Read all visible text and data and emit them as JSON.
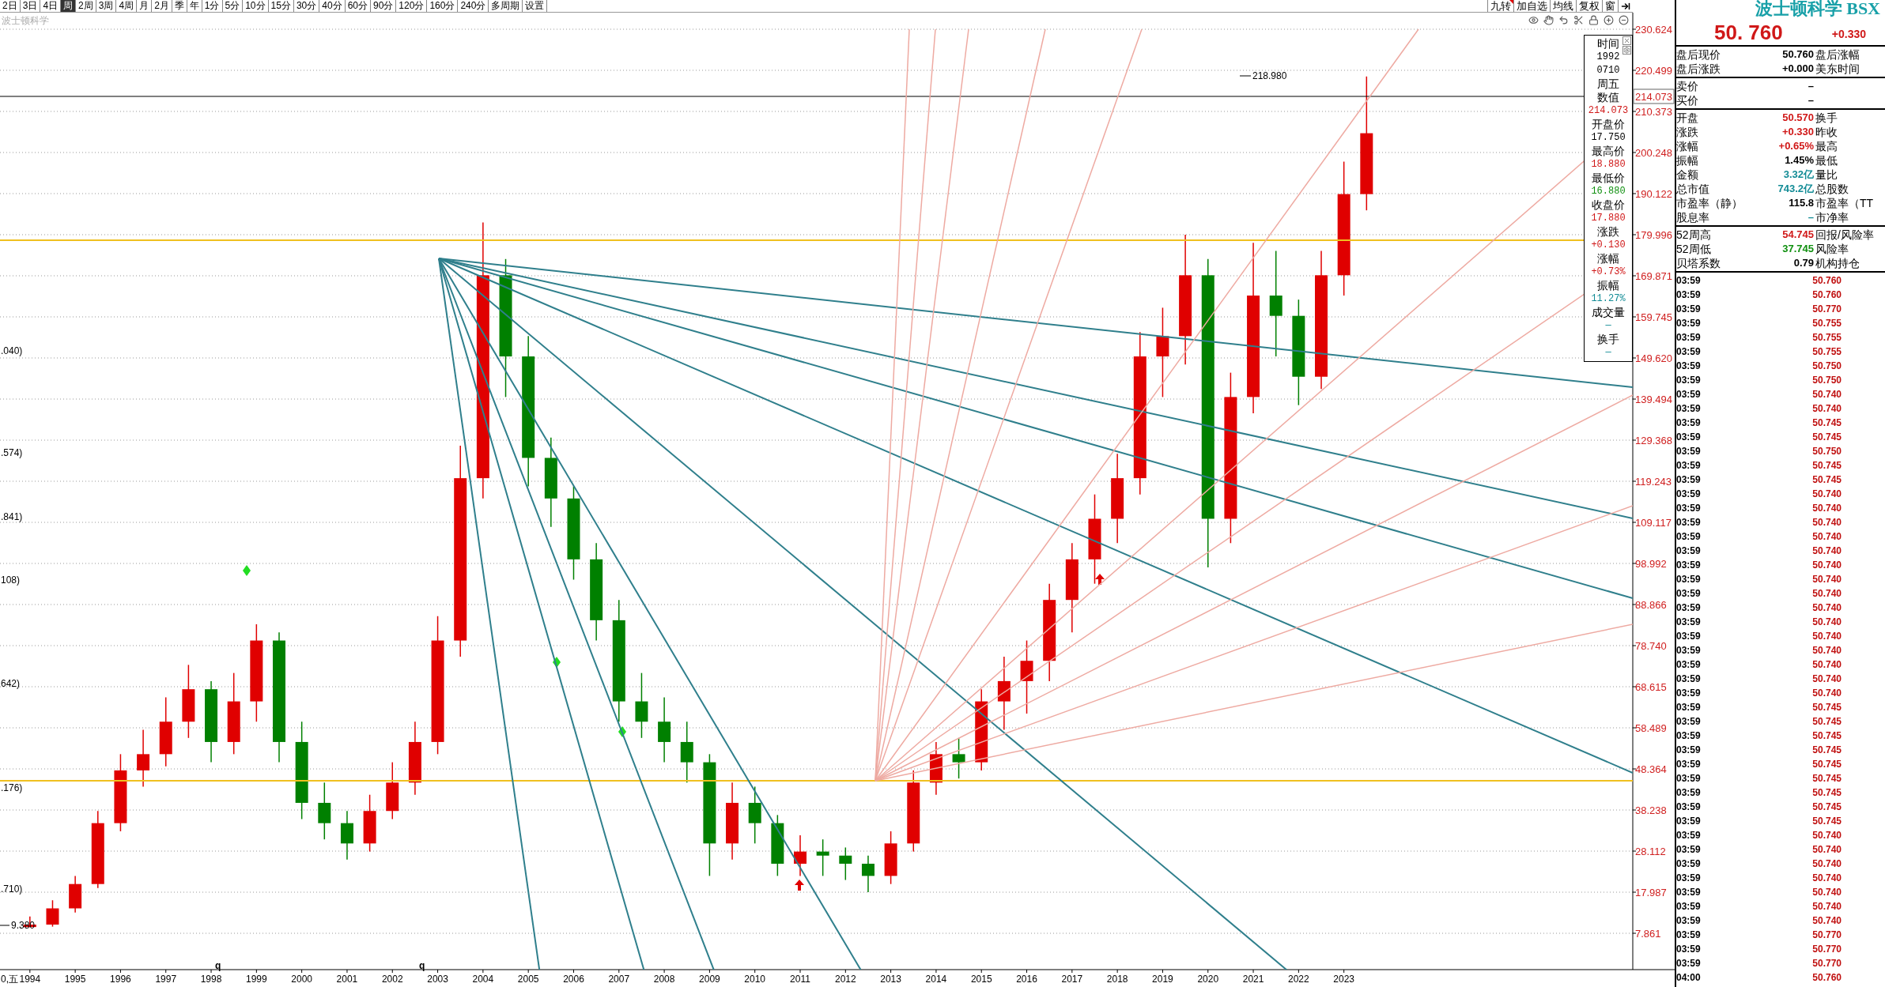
{
  "toolbar": {
    "periods": [
      {
        "label": "2日",
        "selected": false
      },
      {
        "label": "3日",
        "selected": false
      },
      {
        "label": "4日",
        "selected": false
      },
      {
        "label": "周",
        "selected": true
      },
      {
        "label": "2周",
        "selected": false
      },
      {
        "label": "3周",
        "selected": false
      },
      {
        "label": "4周",
        "selected": false
      },
      {
        "label": "月",
        "selected": false
      },
      {
        "label": "2月",
        "selected": false
      },
      {
        "label": "季",
        "selected": false
      },
      {
        "label": "年",
        "selected": false
      },
      {
        "label": "1分",
        "selected": false
      },
      {
        "label": "5分",
        "selected": false
      },
      {
        "label": "10分",
        "selected": false
      },
      {
        "label": "15分",
        "selected": false
      },
      {
        "label": "30分",
        "selected": false
      },
      {
        "label": "40分",
        "selected": false
      },
      {
        "label": "60分",
        "selected": false
      },
      {
        "label": "90分",
        "selected": false
      },
      {
        "label": "120分",
        "selected": false
      },
      {
        "label": "160分",
        "selected": false
      },
      {
        "label": "240分",
        "selected": false
      },
      {
        "label": "多周期",
        "selected": false
      },
      {
        "label": "设置",
        "selected": false
      }
    ],
    "buttons": [
      {
        "label": "九转",
        "flagged": true
      },
      {
        "label": "加自选",
        "flagged": false
      },
      {
        "label": "均线",
        "flagged": false
      },
      {
        "label": "复权",
        "flagged": false
      },
      {
        "label": "窗",
        "flagged": false
      }
    ]
  },
  "chart": {
    "symbol_label": "波士顿科学",
    "axis_start_label": "0,五",
    "cursor_value": "214.073",
    "left_labels": [
      ".040)",
      ".574)",
      ".841)",
      "108)",
      "642)",
      ".176)",
      ".710)"
    ],
    "annotations": [
      {
        "kind": "high",
        "label": "218.980"
      },
      {
        "kind": "low",
        "label": "9.380"
      },
      {
        "kind": "flag",
        "label": "q"
      },
      {
        "kind": "flag",
        "label": "q"
      }
    ],
    "chart_data": {
      "type": "candlestick",
      "x": [
        1994,
        1994.5,
        1995,
        1995.5,
        1996,
        1996.5,
        1997,
        1997.5,
        1998,
        1998.5,
        1999,
        1999.5,
        2000,
        2000.5,
        2001,
        2001.5,
        2002,
        2002.5,
        2003,
        2003.5,
        2004,
        2004.5,
        2005,
        2005.5,
        2006,
        2006.5,
        2007,
        2007.5,
        2008,
        2008.5,
        2009,
        2009.5,
        2010,
        2010.5,
        2011,
        2011.5,
        2012,
        2012.5,
        2013,
        2013.5,
        2014,
        2014.5,
        2015,
        2015.5,
        2016,
        2016.5,
        2017,
        2017.5,
        2018,
        2018.5,
        2019,
        2019.5,
        2020,
        2020.5,
        2021,
        2021.5,
        2022,
        2022.5,
        2023,
        2023.5
      ],
      "ohlc": [
        [
          9.4,
          12,
          9.38,
          10
        ],
        [
          10,
          16,
          9.5,
          14
        ],
        [
          14,
          22,
          13,
          20
        ],
        [
          20,
          38,
          19,
          35
        ],
        [
          35,
          52,
          33,
          48
        ],
        [
          48,
          58,
          44,
          52
        ],
        [
          52,
          66,
          49,
          60
        ],
        [
          60,
          74,
          56,
          68
        ],
        [
          68,
          70,
          50,
          55
        ],
        [
          55,
          72,
          52,
          65
        ],
        [
          65,
          84,
          60,
          80
        ],
        [
          80,
          82,
          50,
          55
        ],
        [
          55,
          60,
          36,
          40
        ],
        [
          40,
          45,
          31,
          35
        ],
        [
          35,
          38,
          26,
          30
        ],
        [
          30,
          42,
          28,
          38
        ],
        [
          38,
          50,
          36,
          45
        ],
        [
          45,
          60,
          42,
          55
        ],
        [
          55,
          86,
          52,
          80
        ],
        [
          80,
          128,
          76,
          120
        ],
        [
          120,
          183,
          115,
          170
        ],
        [
          170,
          174,
          140,
          150
        ],
        [
          150,
          155,
          118,
          125
        ],
        [
          125,
          130,
          108,
          115
        ],
        [
          115,
          118,
          95,
          100
        ],
        [
          100,
          104,
          80,
          85
        ],
        [
          85,
          90,
          60,
          65
        ],
        [
          65,
          72,
          56,
          60
        ],
        [
          60,
          66,
          50,
          55
        ],
        [
          55,
          60,
          45,
          50
        ],
        [
          50,
          52,
          22,
          30
        ],
        [
          30,
          45,
          26,
          40
        ],
        [
          40,
          44,
          30,
          35
        ],
        [
          35,
          37,
          22,
          25
        ],
        [
          25,
          32,
          22,
          28
        ],
        [
          28,
          31,
          22,
          27
        ],
        [
          27,
          29,
          21,
          25
        ],
        [
          25,
          27,
          18,
          22
        ],
        [
          22,
          33,
          20,
          30
        ],
        [
          30,
          48,
          28,
          45
        ],
        [
          45,
          55,
          42,
          52
        ],
        [
          52,
          56,
          46,
          50
        ],
        [
          50,
          68,
          48,
          65
        ],
        [
          65,
          76,
          58,
          70
        ],
        [
          70,
          80,
          62,
          75
        ],
        [
          75,
          94,
          70,
          90
        ],
        [
          90,
          104,
          82,
          100
        ],
        [
          100,
          116,
          94,
          110
        ],
        [
          110,
          126,
          104,
          120
        ],
        [
          120,
          156,
          116,
          150
        ],
        [
          150,
          162,
          140,
          155
        ],
        [
          155,
          180,
          148,
          170
        ],
        [
          170,
          174,
          98,
          110
        ],
        [
          110,
          146,
          104,
          140
        ],
        [
          140,
          178,
          136,
          165
        ],
        [
          165,
          176,
          150,
          160
        ],
        [
          160,
          164,
          138,
          145
        ],
        [
          145,
          176,
          142,
          170
        ],
        [
          170,
          198,
          165,
          190
        ],
        [
          190,
          218.98,
          186,
          205
        ]
      ],
      "xlim": [
        1993.34,
        2030.3
      ],
      "ylim": [
        -1.09,
        234.71
      ],
      "grid": true,
      "xticks": [
        {
          "value": 1994,
          "label": "1994"
        },
        {
          "value": 1995,
          "label": "1995"
        },
        {
          "value": 1996,
          "label": "1996"
        },
        {
          "value": 1997,
          "label": "1997"
        },
        {
          "value": 1998,
          "label": "1998"
        },
        {
          "value": 1999,
          "label": "1999"
        },
        {
          "value": 2000,
          "label": "2000"
        },
        {
          "value": 2001,
          "label": "2001"
        },
        {
          "value": 2002,
          "label": "2002"
        },
        {
          "value": 2003,
          "label": "2003"
        },
        {
          "value": 2004,
          "label": "2004"
        },
        {
          "value": 2005,
          "label": "2005"
        },
        {
          "value": 2006,
          "label": "2006"
        },
        {
          "value": 2007,
          "label": "2007"
        },
        {
          "value": 2008,
          "label": "2008"
        },
        {
          "value": 2009,
          "label": "2009"
        },
        {
          "value": 2010,
          "label": "2010"
        },
        {
          "value": 2011,
          "label": "2011"
        },
        {
          "value": 2012,
          "label": "2012"
        },
        {
          "value": 2013,
          "label": "2013"
        },
        {
          "value": 2014,
          "label": "2014"
        },
        {
          "value": 2015,
          "label": "2015"
        },
        {
          "value": 2016,
          "label": "2016"
        },
        {
          "value": 2017,
          "label": "2017"
        },
        {
          "value": 2018,
          "label": "2018"
        },
        {
          "value": 2019,
          "label": "2019"
        },
        {
          "value": 2020,
          "label": "2020"
        },
        {
          "value": 2021,
          "label": "2021"
        },
        {
          "value": 2022,
          "label": "2022"
        },
        {
          "value": 2023,
          "label": "2023"
        }
      ],
      "yticks": [
        {
          "value": 230.624,
          "label": "230.624"
        },
        {
          "value": 220.499,
          "label": "220.499"
        },
        {
          "value": 210.373,
          "label": "210.373"
        },
        {
          "value": 200.248,
          "label": "200.248"
        },
        {
          "value": 190.122,
          "label": "190.122"
        },
        {
          "value": 179.996,
          "label": "179.996"
        },
        {
          "value": 169.871,
          "label": "169.871"
        },
        {
          "value": 159.745,
          "label": "159.745"
        },
        {
          "value": 149.62,
          "label": "149.620"
        },
        {
          "value": 139.494,
          "label": "139.494"
        },
        {
          "value": 129.368,
          "label": "129.368"
        },
        {
          "value": 119.243,
          "label": "119.243"
        },
        {
          "value": 109.117,
          "label": "109.117"
        },
        {
          "value": 98.992,
          "label": "98.992"
        },
        {
          "value": 88.866,
          "label": "88.866"
        },
        {
          "value": 78.74,
          "label": "78.740"
        },
        {
          "value": 68.615,
          "label": "68.615"
        },
        {
          "value": 58.489,
          "label": "58.489"
        },
        {
          "value": 48.364,
          "label": "48.364"
        },
        {
          "value": 38.238,
          "label": "38.238"
        },
        {
          "value": 28.112,
          "label": "28.112"
        },
        {
          "value": 17.987,
          "label": "17.987"
        },
        {
          "value": 7.861,
          "label": "7.861"
        }
      ]
    }
  },
  "tooltip": {
    "rows": [
      {
        "text": "时间",
        "kind": "label"
      },
      {
        "text": "1992",
        "kind": "plain"
      },
      {
        "text": "0710",
        "kind": "plain"
      },
      {
        "text": "周五",
        "kind": "label"
      },
      {
        "text": "数值",
        "kind": "label"
      },
      {
        "text": "214.073",
        "kind": "red"
      },
      {
        "text": "开盘价",
        "kind": "label"
      },
      {
        "text": "17.750",
        "kind": "plain"
      },
      {
        "text": "最高价",
        "kind": "label"
      },
      {
        "text": "18.880",
        "kind": "red"
      },
      {
        "text": "最低价",
        "kind": "label"
      },
      {
        "text": "16.880",
        "kind": "green"
      },
      {
        "text": "收盘价",
        "kind": "label"
      },
      {
        "text": "17.880",
        "kind": "red"
      },
      {
        "text": "涨跌",
        "kind": "label"
      },
      {
        "text": "+0.130",
        "kind": "red"
      },
      {
        "text": "涨幅",
        "kind": "label"
      },
      {
        "text": "+0.73%",
        "kind": "red"
      },
      {
        "text": "振幅",
        "kind": "label"
      },
      {
        "text": "11.27%",
        "kind": "teal"
      },
      {
        "text": "成交量",
        "kind": "label"
      },
      {
        "text": "—",
        "kind": "teal"
      },
      {
        "text": "换手",
        "kind": "label"
      },
      {
        "text": "—",
        "kind": "teal"
      }
    ]
  },
  "quote": {
    "title": "波士顿科学 BSX",
    "price": "50. 760",
    "change": "+0.330",
    "sections": [
      [
        {
          "label": "盘后现价",
          "value": "50.760",
          "kind": "plain",
          "label2": "盘后涨幅"
        },
        {
          "label": "盘后涨跌",
          "value": "+0.000",
          "kind": "plain",
          "label2": "美东时间"
        }
      ],
      [
        {
          "label": "卖价",
          "value": "–",
          "kind": "plain"
        },
        {
          "label": "买价",
          "value": "–",
          "kind": "plain"
        }
      ],
      [
        {
          "label": "开盘",
          "value": "50.570",
          "kind": "red",
          "label2": "换手"
        },
        {
          "label": "涨跌",
          "value": "+0.330",
          "kind": "red",
          "label2": "昨收"
        },
        {
          "label": "涨幅",
          "value": "+0.65%",
          "kind": "red",
          "label2": "最高"
        },
        {
          "label": "振幅",
          "value": "1.45%",
          "kind": "plain",
          "label2": "最低"
        },
        {
          "label": "金额",
          "value": "3.32亿",
          "kind": "teal",
          "label2": "量比"
        },
        {
          "label": "总市值",
          "value": "743.2亿",
          "kind": "teal",
          "label2": "总股数"
        },
        {
          "label": "市盈率（静）",
          "value": "115.8",
          "kind": "plain",
          "label2": "市盈率（TT"
        },
        {
          "label": "股息率",
          "value": "–",
          "kind": "teal",
          "label2": "市净率"
        }
      ],
      [
        {
          "label": "52周高",
          "value": "54.745",
          "kind": "red",
          "label2": "回报/风险率"
        },
        {
          "label": "52周低",
          "value": "37.745",
          "kind": "green",
          "label2": "风险率"
        },
        {
          "label": "贝塔系数",
          "value": "0.79",
          "kind": "plain",
          "label2": "机构持仓"
        }
      ]
    ]
  },
  "ticks": [
    {
      "time": "03:59",
      "price": "50.760"
    },
    {
      "time": "03:59",
      "price": "50.760"
    },
    {
      "time": "03:59",
      "price": "50.770"
    },
    {
      "time": "03:59",
      "price": "50.755"
    },
    {
      "time": "03:59",
      "price": "50.755"
    },
    {
      "time": "03:59",
      "price": "50.755"
    },
    {
      "time": "03:59",
      "price": "50.750"
    },
    {
      "time": "03:59",
      "price": "50.750"
    },
    {
      "time": "03:59",
      "price": "50.740"
    },
    {
      "time": "03:59",
      "price": "50.740"
    },
    {
      "time": "03:59",
      "price": "50.745"
    },
    {
      "time": "03:59",
      "price": "50.745"
    },
    {
      "time": "03:59",
      "price": "50.750"
    },
    {
      "time": "03:59",
      "price": "50.745"
    },
    {
      "time": "03:59",
      "price": "50.745"
    },
    {
      "time": "03:59",
      "price": "50.740"
    },
    {
      "time": "03:59",
      "price": "50.740"
    },
    {
      "time": "03:59",
      "price": "50.740"
    },
    {
      "time": "03:59",
      "price": "50.740"
    },
    {
      "time": "03:59",
      "price": "50.740"
    },
    {
      "time": "03:59",
      "price": "50.740"
    },
    {
      "time": "03:59",
      "price": "50.740"
    },
    {
      "time": "03:59",
      "price": "50.740"
    },
    {
      "time": "03:59",
      "price": "50.740"
    },
    {
      "time": "03:59",
      "price": "50.740"
    },
    {
      "time": "03:59",
      "price": "50.740"
    },
    {
      "time": "03:59",
      "price": "50.740"
    },
    {
      "time": "03:59",
      "price": "50.740"
    },
    {
      "time": "03:59",
      "price": "50.740"
    },
    {
      "time": "03:59",
      "price": "50.740"
    },
    {
      "time": "03:59",
      "price": "50.745"
    },
    {
      "time": "03:59",
      "price": "50.745"
    },
    {
      "time": "03:59",
      "price": "50.745"
    },
    {
      "time": "03:59",
      "price": "50.745"
    },
    {
      "time": "03:59",
      "price": "50.745"
    },
    {
      "time": "03:59",
      "price": "50.745"
    },
    {
      "time": "03:59",
      "price": "50.745"
    },
    {
      "time": "03:59",
      "price": "50.745"
    },
    {
      "time": "03:59",
      "price": "50.745"
    },
    {
      "time": "03:59",
      "price": "50.740"
    },
    {
      "time": "03:59",
      "price": "50.740"
    },
    {
      "time": "03:59",
      "price": "50.740"
    },
    {
      "time": "03:59",
      "price": "50.740"
    },
    {
      "time": "03:59",
      "price": "50.740"
    },
    {
      "time": "03:59",
      "price": "50.740"
    },
    {
      "time": "03:59",
      "price": "50.740"
    },
    {
      "time": "03:59",
      "price": "50.770"
    },
    {
      "time": "03:59",
      "price": "50.770"
    },
    {
      "time": "03:59",
      "price": "50.770"
    },
    {
      "time": "04:00",
      "price": "50.760"
    }
  ]
}
